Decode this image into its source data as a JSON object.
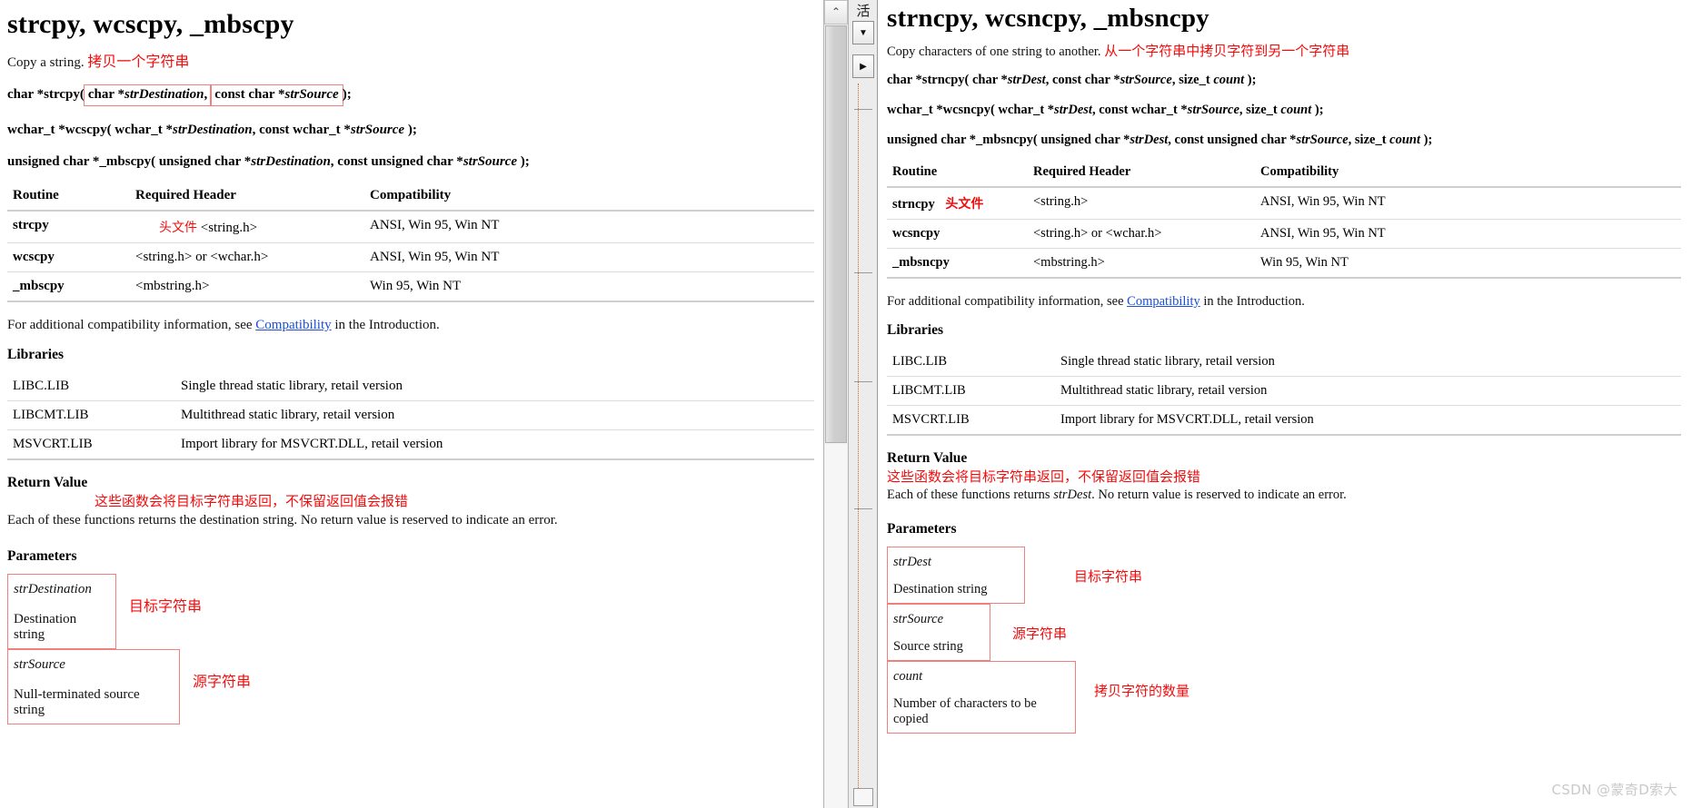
{
  "left": {
    "title": "strcpy, wcscpy, _mbscpy",
    "summary": "Copy a string.",
    "summary_note": "拷贝一个字符串",
    "prototypes": [
      {
        "prefix": "char *strcpy(",
        "arg1": "char *strDestination,",
        "arg1_plain": "char *",
        "arg1_italic": "strDestination",
        "arg2_plain": "const char *",
        "arg2_italic": "strSource",
        "suffix": ");"
      },
      {
        "plain1": "wchar_t *wcscpy( wchar_t *",
        "italic1": "strDestination",
        "plain2": ", const wchar_t *",
        "italic2": "strSource",
        "suffix": " );"
      },
      {
        "plain1": "unsigned char *_mbscpy( unsigned char *",
        "italic1": "strDestination",
        "plain2": ", const unsigned char *",
        "italic2": "strSource",
        "suffix": " );"
      }
    ],
    "routine_table": {
      "headers": [
        "Routine",
        "Required Header",
        "Compatibility"
      ],
      "header_note": "头文件",
      "rows": [
        {
          "routine": "strcpy",
          "header": "<string.h>",
          "compatibility": "ANSI, Win 95, Win NT"
        },
        {
          "routine": "wcscpy",
          "header": "<string.h> or <wchar.h>",
          "compatibility": "ANSI, Win 95, Win NT"
        },
        {
          "routine": "_mbscpy",
          "header": "<mbstring.h>",
          "compatibility": "Win 95, Win NT"
        }
      ]
    },
    "compat_line_before": "For additional compatibility information, see ",
    "compat_link": "Compatibility",
    "compat_line_after": " in the Introduction.",
    "libraries_heading": "Libraries",
    "libraries": [
      {
        "name": "LIBC.LIB",
        "desc": "Single thread static library, retail version"
      },
      {
        "name": "LIBCMT.LIB",
        "desc": "Multithread static library, retail version"
      },
      {
        "name": "MSVCRT.LIB",
        "desc": "Import library for MSVCRT.DLL, retail version"
      }
    ],
    "return_heading": "Return Value",
    "return_note": "这些函数会将目标字符串返回，不保留返回值会报错",
    "return_text_a": "Each of these functions returns the destination string. No return value is reserved to indicate an error.",
    "parameters_heading": "Parameters",
    "parameters": [
      {
        "name": "strDestination",
        "desc": "Destination string",
        "note": "目标字符串"
      },
      {
        "name": "strSource",
        "desc": "Null-terminated source string",
        "note": "源字符串"
      }
    ]
  },
  "right": {
    "title": "strncpy, wcsncpy, _mbsncpy",
    "summary": "Copy characters of one string to another.",
    "summary_note": "从一个字符串中拷贝字符到另一个字符串",
    "prototypes": [
      {
        "plain1": "char *strncpy( char *",
        "italic1": "strDest",
        "plain2": ", const char *",
        "italic2": "strSource",
        "plain3": ", size_t ",
        "italic3": "count",
        "suffix": " );"
      },
      {
        "plain1": "wchar_t *wcsncpy( wchar_t *",
        "italic1": "strDest",
        "plain2": ", const wchar_t *",
        "italic2": "strSource",
        "plain3": ", size_t ",
        "italic3": "count",
        "suffix": " );"
      },
      {
        "plain1": "unsigned char *_mbsncpy( unsigned char *",
        "italic1": "strDest",
        "plain2": ", const unsigned char *",
        "italic2": "strSource",
        "plain3": ", size_t ",
        "italic3": "count",
        "suffix": " );"
      }
    ],
    "routine_table": {
      "headers": [
        "Routine",
        "Required Header",
        "Compatibility"
      ],
      "header_note": "头文件",
      "rows": [
        {
          "routine": "strncpy",
          "header": "<string.h>",
          "compatibility": "ANSI, Win 95, Win NT"
        },
        {
          "routine": "wcsncpy",
          "header": "<string.h> or <wchar.h>",
          "compatibility": "ANSI, Win 95, Win NT"
        },
        {
          "routine": "_mbsncpy",
          "header": "<mbstring.h>",
          "compatibility": "Win 95, Win NT"
        }
      ]
    },
    "compat_line_before": "For additional compatibility information, see ",
    "compat_link": "Compatibility",
    "compat_line_after": " in the Introduction.",
    "libraries_heading": "Libraries",
    "libraries": [
      {
        "name": "LIBC.LIB",
        "desc": "Single thread static library, retail version"
      },
      {
        "name": "LIBCMT.LIB",
        "desc": "Multithread static library, retail version"
      },
      {
        "name": "MSVCRT.LIB",
        "desc": "Import library for MSVCRT.DLL, retail version"
      }
    ],
    "return_heading": "Return Value",
    "return_note": "这些函数会将目标字符串返回，不保留返回值会报错",
    "return_text_a": "Each of these functions returns ",
    "return_text_italic": "strDest",
    "return_text_b": ". No return value is reserved to indicate an error.",
    "parameters_heading": "Parameters",
    "parameters": [
      {
        "name": "strDest",
        "desc": "Destination string",
        "note": "目标字符串"
      },
      {
        "name": "strSource",
        "desc": "Source string",
        "note": "源字符串"
      },
      {
        "name": "count",
        "desc": "Number of characters to be copied",
        "note": "拷贝字符的数量"
      }
    ]
  },
  "chrome": {
    "scroll_up_arrow": "⌃",
    "mini_toolbar_label": "活",
    "mini_btn_down": "▼",
    "mini_btn_right": "▶",
    "dots": "⋮⋮⋮⋮⋮⋮⋮⋮⋮"
  },
  "watermark": "CSDN @蒙奇D索大",
  "colors": {
    "annotation_red": "#f20d0d",
    "box_red": "#f08080",
    "link_blue": "#1a4fd6",
    "watermark_gray": "#c9c9c9"
  }
}
